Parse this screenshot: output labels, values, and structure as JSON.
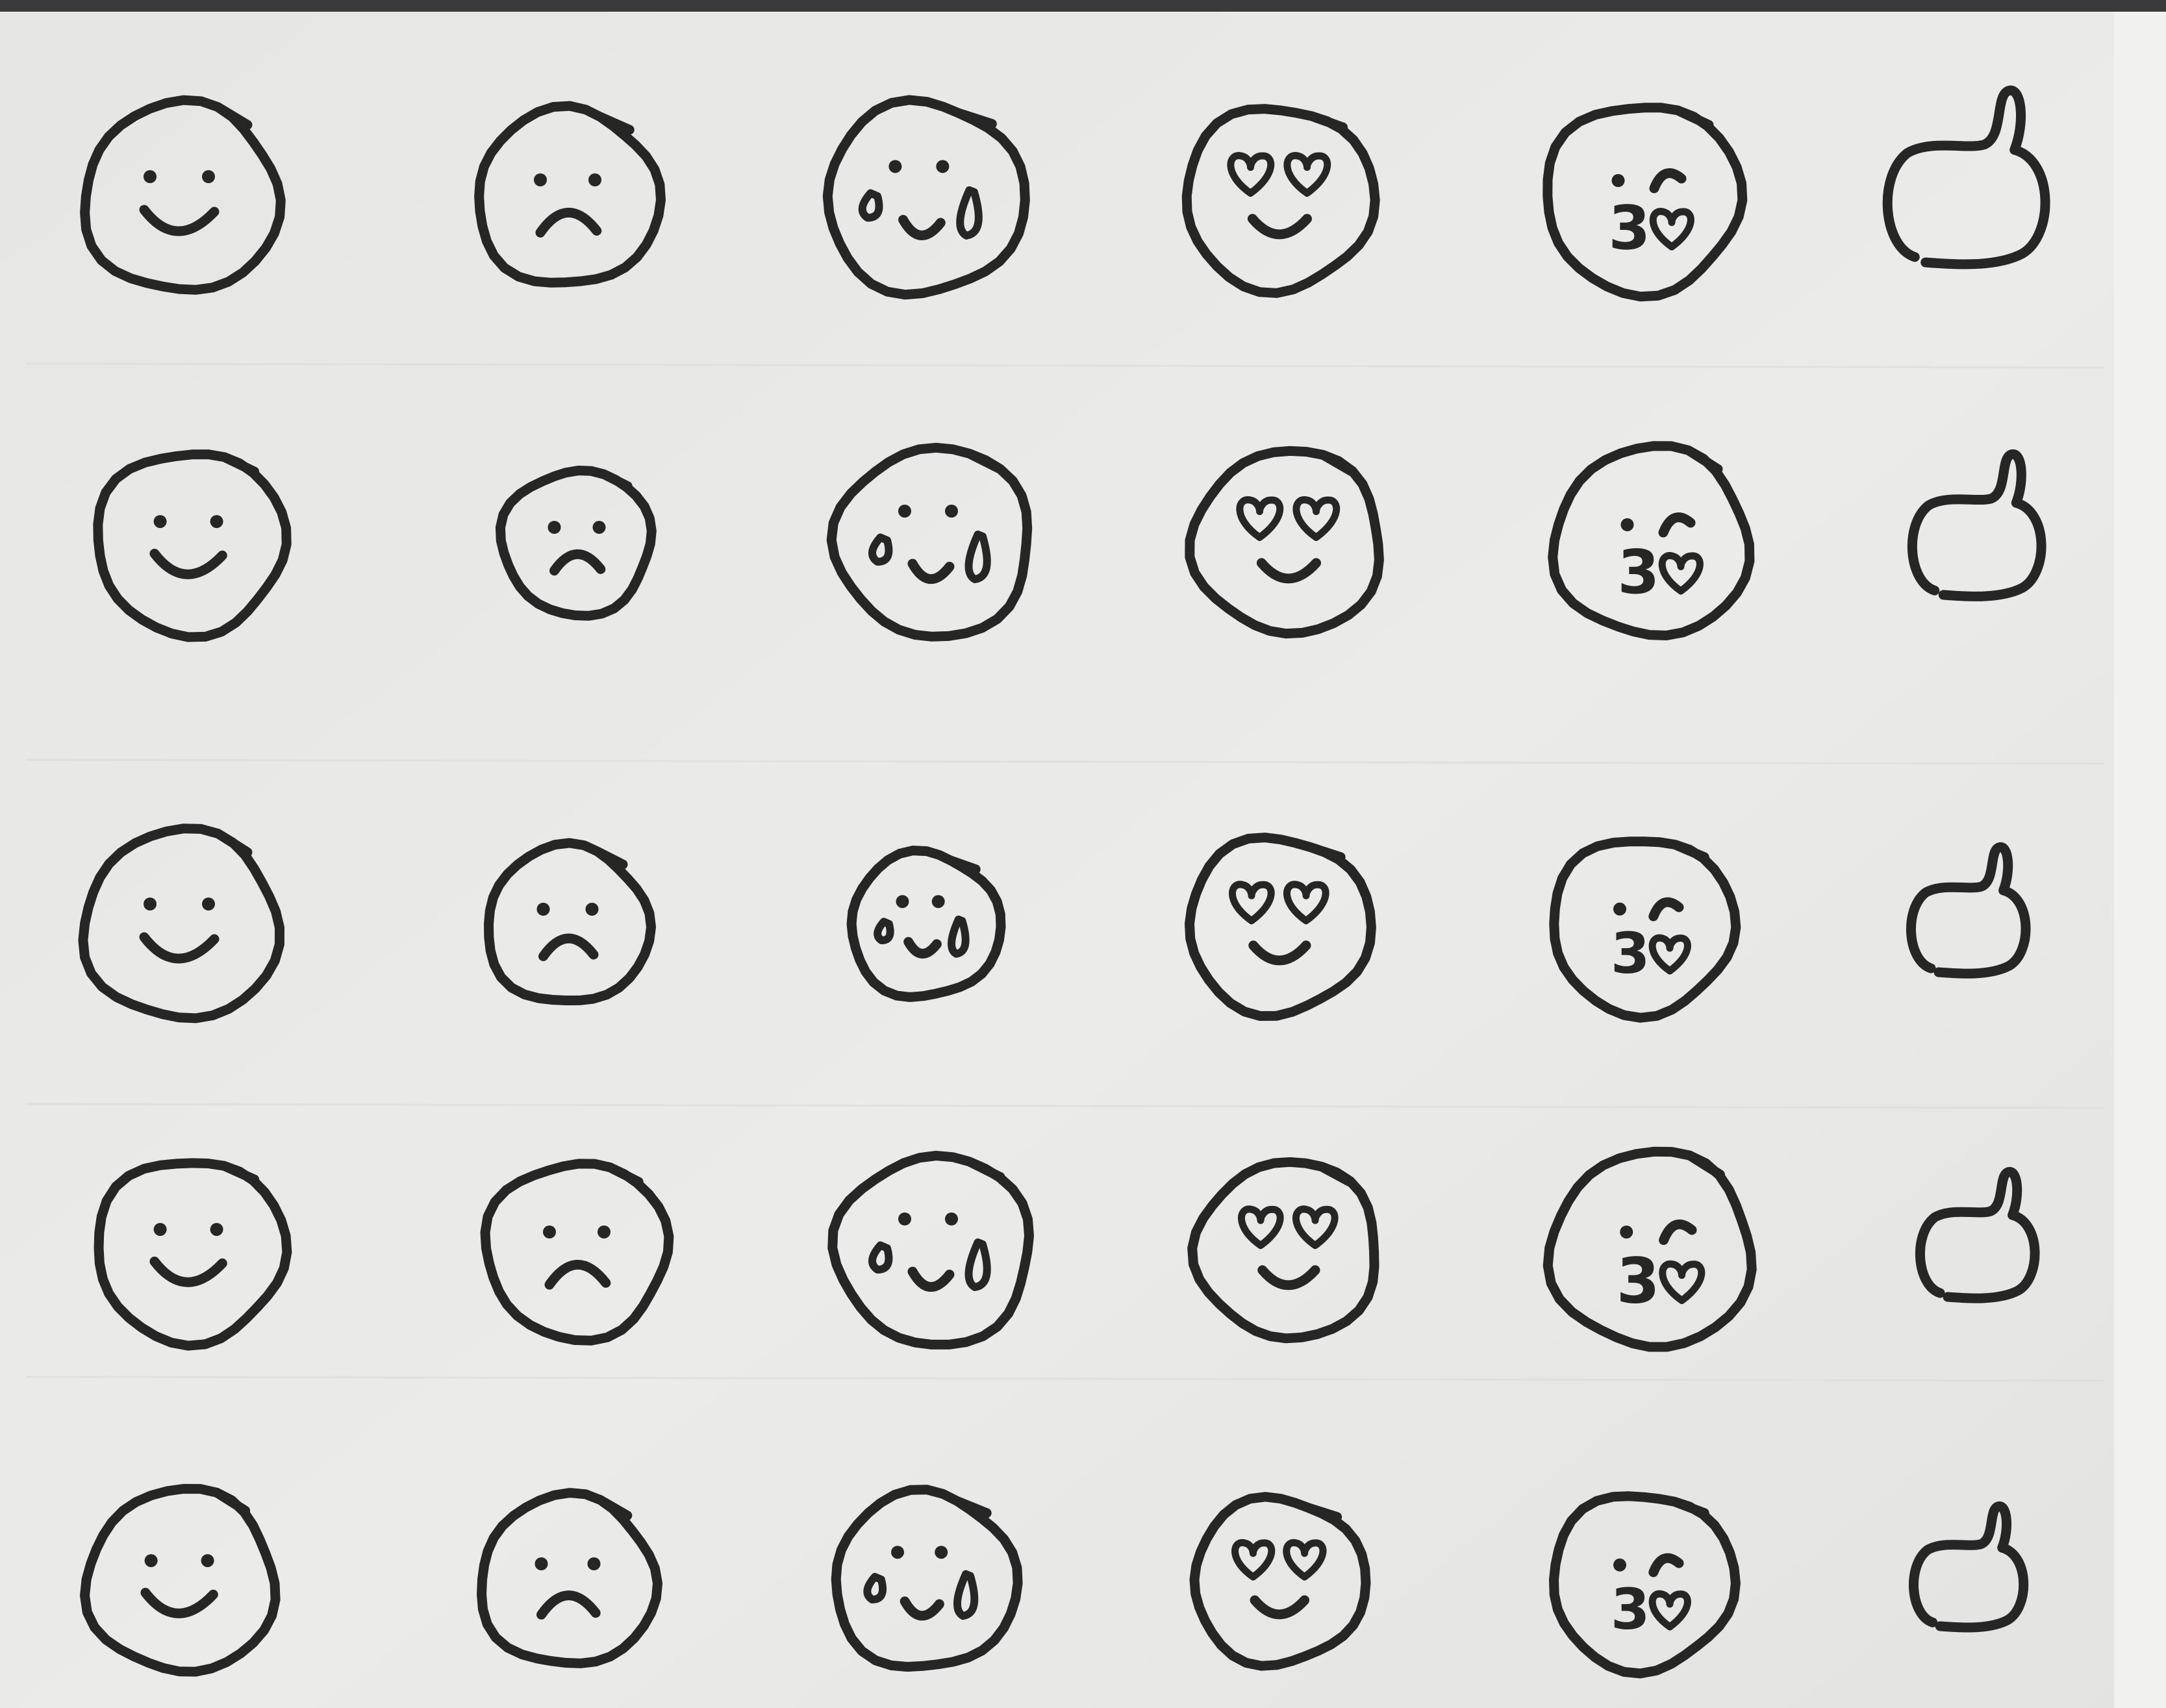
{
  "photo": {
    "ink_color": "#262626",
    "paper_color": "#e9e9e7",
    "paper_edge_color": "#dcdcda",
    "top_edge_color": "#3a3a3c",
    "right_margin_color": "#f1f1ef",
    "column_kinds": [
      "smile",
      "frown",
      "cry",
      "heart-eyes",
      "kiss",
      "thumbs-up"
    ],
    "row_count": 5,
    "kiss_glyph": "3"
  }
}
